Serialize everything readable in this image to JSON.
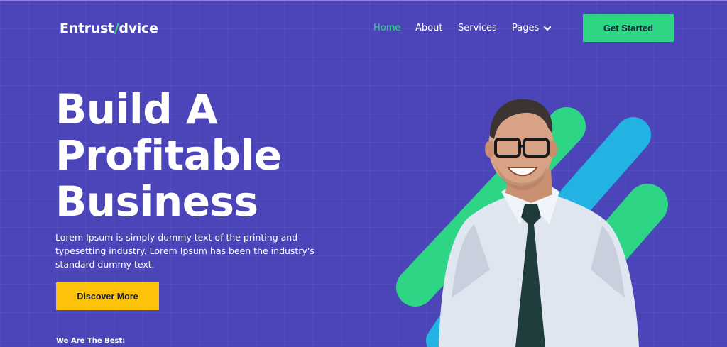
{
  "brand": {
    "logo_text_a": "Entrust",
    "logo_slash": "/",
    "logo_text_b": "dvice"
  },
  "nav": {
    "items": [
      {
        "label": "Home",
        "active": true
      },
      {
        "label": "About",
        "active": false
      },
      {
        "label": "Services",
        "active": false
      },
      {
        "label": "Pages",
        "active": false
      }
    ],
    "cta_label": "Get Started"
  },
  "hero": {
    "title_lines": [
      "Build A",
      "Profitable",
      "Business"
    ],
    "description": "Lorem Ipsum is simply dummy text of the printing and typesetting industry. Lorem Ipsum has been the industry's standard dummy text.",
    "button_label": "Discover More",
    "tagline": "We Are The Best:"
  },
  "icons": {
    "pages_dropdown": "chevron-down-icon"
  },
  "colors": {
    "background": "#4b45b9",
    "accent_green": "#2ed584",
    "accent_yellow": "#fdc20a",
    "accent_blue": "#22b3e3",
    "dark_text": "#14203a"
  }
}
